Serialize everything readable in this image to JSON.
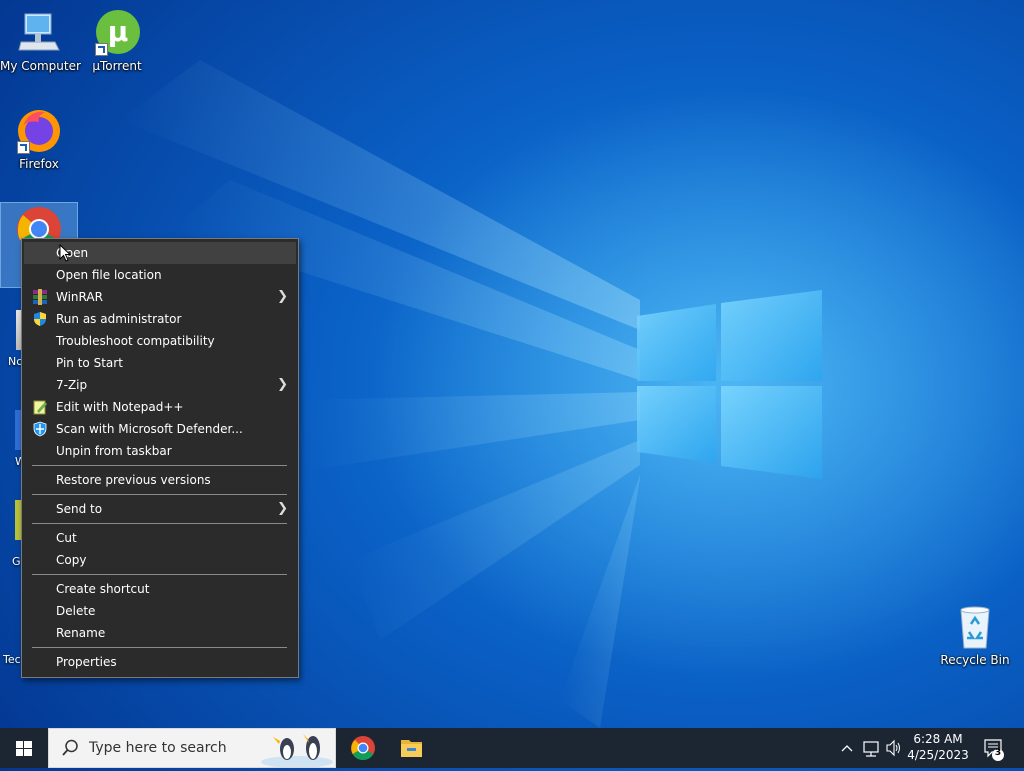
{
  "desktop": {
    "icons": [
      {
        "label": "My Computer"
      },
      {
        "label": "µTorrent"
      },
      {
        "label": "Firefox"
      },
      {
        "label": "Recycle Bin"
      }
    ],
    "partial_labels": [
      "Nc",
      "W",
      "G",
      "Tec"
    ]
  },
  "context_menu": {
    "items": [
      {
        "label": "Open",
        "icon": "none",
        "submenu": false,
        "hover": true
      },
      {
        "label": "Open file location",
        "icon": "none",
        "submenu": false
      },
      {
        "label": "WinRAR",
        "icon": "winrar-icon",
        "submenu": true
      },
      {
        "label": "Run as administrator",
        "icon": "uac-shield-icon",
        "submenu": false
      },
      {
        "label": "Troubleshoot compatibility",
        "icon": "none",
        "submenu": false
      },
      {
        "label": "Pin to Start",
        "icon": "none",
        "submenu": false
      },
      {
        "label": "7-Zip",
        "icon": "none",
        "submenu": true
      },
      {
        "label": "Edit with Notepad++",
        "icon": "notepadpp-icon",
        "submenu": false
      },
      {
        "label": "Scan with Microsoft Defender...",
        "icon": "defender-icon",
        "submenu": false
      },
      {
        "label": "Unpin from taskbar",
        "icon": "none",
        "submenu": false
      },
      {
        "label": "Restore previous versions",
        "icon": "none",
        "submenu": false
      },
      {
        "label": "Send to",
        "icon": "none",
        "submenu": true
      },
      {
        "label": "Cut",
        "icon": "none",
        "submenu": false
      },
      {
        "label": "Copy",
        "icon": "none",
        "submenu": false
      },
      {
        "label": "Create shortcut",
        "icon": "none",
        "submenu": false
      },
      {
        "label": "Delete",
        "icon": "none",
        "submenu": false
      },
      {
        "label": "Rename",
        "icon": "none",
        "submenu": false
      },
      {
        "label": "Properties",
        "icon": "none",
        "submenu": false
      }
    ]
  },
  "taskbar": {
    "search_placeholder": "Type here to search",
    "pinned": [
      "chrome-icon",
      "file-explorer-icon"
    ],
    "clock": {
      "time": "6:28 AM",
      "date": "4/25/2023"
    },
    "notification_count": "3"
  },
  "colors": {
    "menu_bg": "#2b2b2b",
    "menu_hover": "#414141",
    "taskbar_bg": "#1c2633",
    "desktop_accent": "#0a5fc4"
  }
}
